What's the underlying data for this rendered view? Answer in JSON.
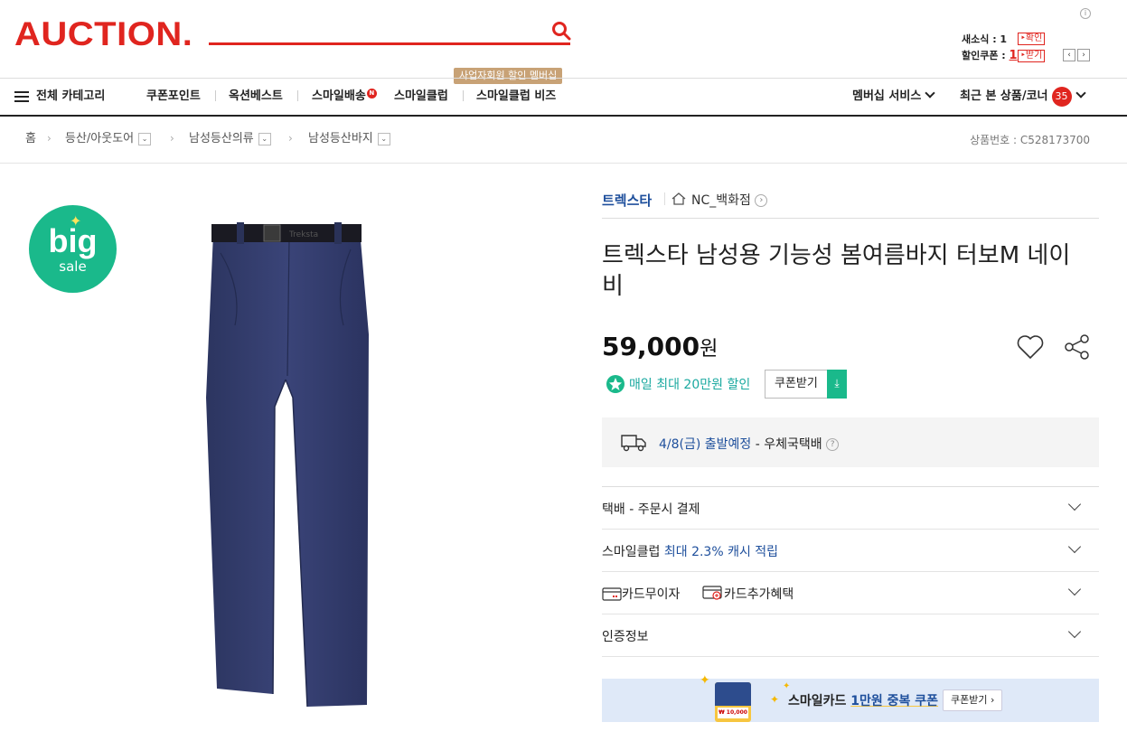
{
  "header": {
    "logo": "AUCTION.",
    "notification_label": "새소식 : 1",
    "notification_button": "확인",
    "coupon_label": "할인쿠폰 : ",
    "coupon_count": "1",
    "coupon_button": "받기"
  },
  "gnb": {
    "category": "전체 카테고리",
    "items": [
      "쿠폰포인트",
      "옥션베스트",
      "스마일배송",
      "스마일클럽",
      "스마일클럽 비즈"
    ],
    "new_badge": "N",
    "biz_tooltip": "사업자회원 할인 멤버십",
    "membership": "멤버십 서비스",
    "recent": "최근 본 상품/코너",
    "recent_count": "35"
  },
  "breadcrumb": {
    "items": [
      "홈",
      "등산/아웃도어",
      "남성등산의류",
      "남성등산바지"
    ],
    "product_no": "상품번호 : C528173700"
  },
  "product": {
    "badge_big": "big",
    "badge_sale": "sale",
    "brand": "트렉스타",
    "shop": "NC_백화점",
    "title": "트렉스타 남성용 기능성 봄여름바지 터보M 네이비",
    "price": "59,000",
    "currency": "원",
    "discount_text": "매일 최대 20만원 할인",
    "coupon_button": "쿠폰받기",
    "shipping_date": "4/8(금) 출발예정",
    "shipping_carrier": " - 우체국택배",
    "rows": {
      "delivery": "택배 - 주문시 결제",
      "smileclub_prefix": "스마일클럽 ",
      "smileclub_highlight": "최대 2.3% 캐시 적립",
      "card_free": "카드무이자",
      "card_benefit": "카드추가혜택",
      "certification": "인증정보"
    },
    "banner": {
      "prefix": "스마일카드 ",
      "highlight": "1만원 중복 쿠폰",
      "button": "쿠폰받기 ›",
      "card_amount": "₩ 10,000"
    }
  },
  "colors": {
    "brand_red": "#e0251f",
    "link_blue": "#1e4f9c",
    "accent_green": "#1ab98b",
    "tooltip": "#c8a276"
  }
}
